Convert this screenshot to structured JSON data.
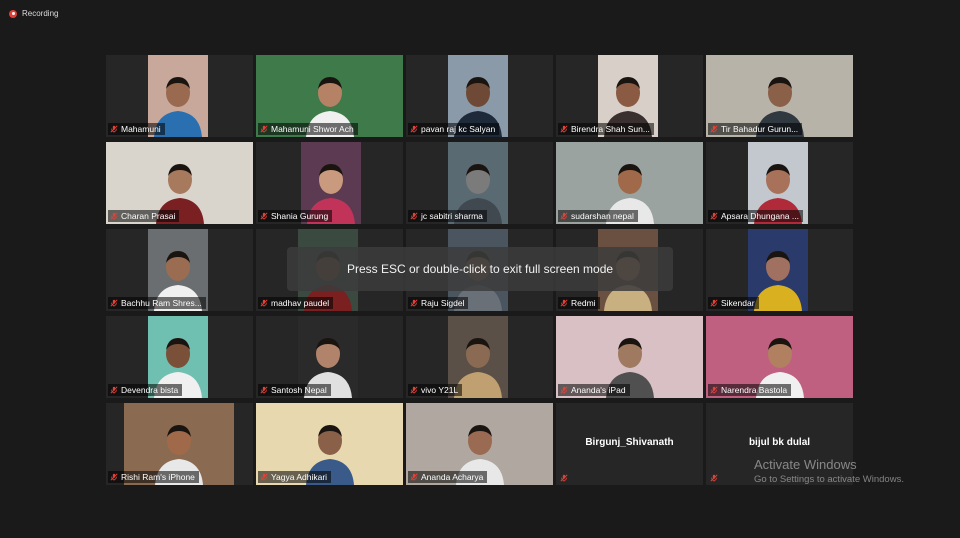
{
  "recording": {
    "label": "Recording"
  },
  "toast": {
    "text": "Press ESC or double-click to exit full screen mode"
  },
  "watermark": {
    "title": "Activate Windows",
    "subtitle": "Go to Settings to activate Windows."
  },
  "colors": {
    "background": "#1a1a1a",
    "tile": "#262626",
    "active_speaker": "#d8e34a",
    "recording": "#e03e36",
    "muted_mic": "#e0433a"
  },
  "participants": [
    {
      "name": "Mahamuni",
      "bg": "#c8a89a",
      "skin": "#9a6a50",
      "shirt": "#2a6fb0"
    },
    {
      "name": "Mahamuni Shwor Ach",
      "bg": "#3f7a4a",
      "skin": "#b58265",
      "shirt": "#f0f0f0"
    },
    {
      "name": "pavan raj kc  Salyan",
      "bg": "#8a9aa8",
      "skin": "#6e4a36",
      "shirt": "#1e2a3a"
    },
    {
      "name": "Birendra Shah Sun...",
      "bg": "#d8d0c8",
      "skin": "#8a5a42",
      "shirt": "#3a3030"
    },
    {
      "name": "Tir Bahadur Gurun...",
      "bg": "#b8b3a8",
      "skin": "#8a6048",
      "shirt": "#303840"
    },
    {
      "name": "Charan Prasai",
      "bg": "#d9d4cc",
      "skin": "#a77a5e",
      "shirt": "#7a1f22"
    },
    {
      "name": "Shania Gurung",
      "bg": "#5b3a52",
      "skin": "#c99a7e",
      "shirt": "#c2335a"
    },
    {
      "name": "jc sabitri sharma",
      "bg": "#5a6a72",
      "skin": "#7b7b7b",
      "shirt": "#404850"
    },
    {
      "name": "sudarshan nepal",
      "bg": "#9aa3a0",
      "skin": "#a06a4a",
      "shirt": "#e8e8e8"
    },
    {
      "name": "Apsara Dhungana ...",
      "bg": "#c2c8ce",
      "skin": "#a8725a",
      "shirt": "#b02a3a"
    },
    {
      "name": "Bachhu Ram Shres...",
      "bg": "#6a6e70",
      "skin": "#9a6d52",
      "shirt": "#f0f0f0"
    },
    {
      "name": "madhav paudel",
      "bg": "#3a4a40",
      "skin": "#7a5040",
      "shirt": "#7a2020"
    },
    {
      "name": "Raju Sigdel",
      "bg": "#4a5560",
      "skin": "#8a6a52",
      "shirt": "#6a7078"
    },
    {
      "name": "Redmi",
      "bg": "#6a5040",
      "skin": "#b08060",
      "shirt": "#c8b080"
    },
    {
      "name": "Sikendar",
      "bg": "#2a3a6a",
      "skin": "#a07060",
      "shirt": "#d8b020"
    },
    {
      "name": "Devendra bista",
      "bg": "#6fc0b0",
      "skin": "#7a5038",
      "shirt": "#f0f0f0"
    },
    {
      "name": "Santosh Nepal",
      "bg": "#2a2a2a",
      "skin": "#b0836a",
      "shirt": "#e0e0e0"
    },
    {
      "name": "vivo Y21L",
      "bg": "#5a5048",
      "skin": "#8a6a52",
      "shirt": "#c0a070"
    },
    {
      "name": "Ananda's iPad",
      "bg": "#d8c0c4",
      "skin": "#a07a60",
      "shirt": "#505050"
    },
    {
      "name": "Narendra Bastola",
      "bg": "#c06080",
      "skin": "#b08060",
      "shirt": "#f0f0f0"
    },
    {
      "name": "Rishi Ram's iPhone",
      "bg": "#8a6a50",
      "skin": "#a06a4a",
      "shirt": "#e8e8e8"
    },
    {
      "name": "Yagya  Adhikari",
      "bg": "#e8d8b0",
      "skin": "#8a6048",
      "shirt": "#3a5a8a"
    },
    {
      "name": "Ananda Acharya",
      "bg": "#b0a8a0",
      "skin": "#9a6a52",
      "shirt": "#e8e8e8"
    },
    {
      "name": "Birgunj_Shivanath",
      "video": false
    },
    {
      "name": "bijul bk dulal",
      "video": false
    }
  ]
}
